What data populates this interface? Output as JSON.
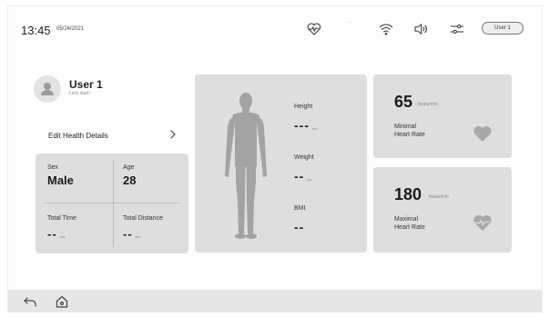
{
  "status_bar": {
    "time": "13:45",
    "date": "05/24/2021",
    "mark": "-",
    "icons": [
      "heart-rate-icon",
      "wifi-icon",
      "speaker-icon",
      "settings-sliders-icon"
    ],
    "user_button": "User 1"
  },
  "profile": {
    "name": "User 1",
    "subtitle": "Let's start!",
    "edit_link": "Edit Health Details"
  },
  "stats": {
    "sex_label": "Sex",
    "sex_value": "Male",
    "age_label": "Age",
    "age_value": "28",
    "time_label": "Total Time",
    "time_value": "--",
    "time_unit": "min",
    "distance_label": "Total Distance",
    "distance_value": "--",
    "distance_unit": "km"
  },
  "body_metrics": {
    "height_label": "Height",
    "height_value": "---",
    "height_unit": "cm",
    "weight_label": "Weight",
    "weight_value": "--",
    "weight_unit": "kg",
    "bmi_label": "BMI",
    "bmi_value": "--"
  },
  "heart_rate": {
    "min_value": "65",
    "min_unit": "beats/min",
    "min_label_line1": "Minimal",
    "min_label_line2": "Heart Rate",
    "max_value": "180",
    "max_unit": "beats/min",
    "max_label_line1": "Maximal",
    "max_label_line2": "Heart Rate"
  },
  "bottom_nav": {
    "icons": [
      "back-icon",
      "home-icon"
    ]
  }
}
